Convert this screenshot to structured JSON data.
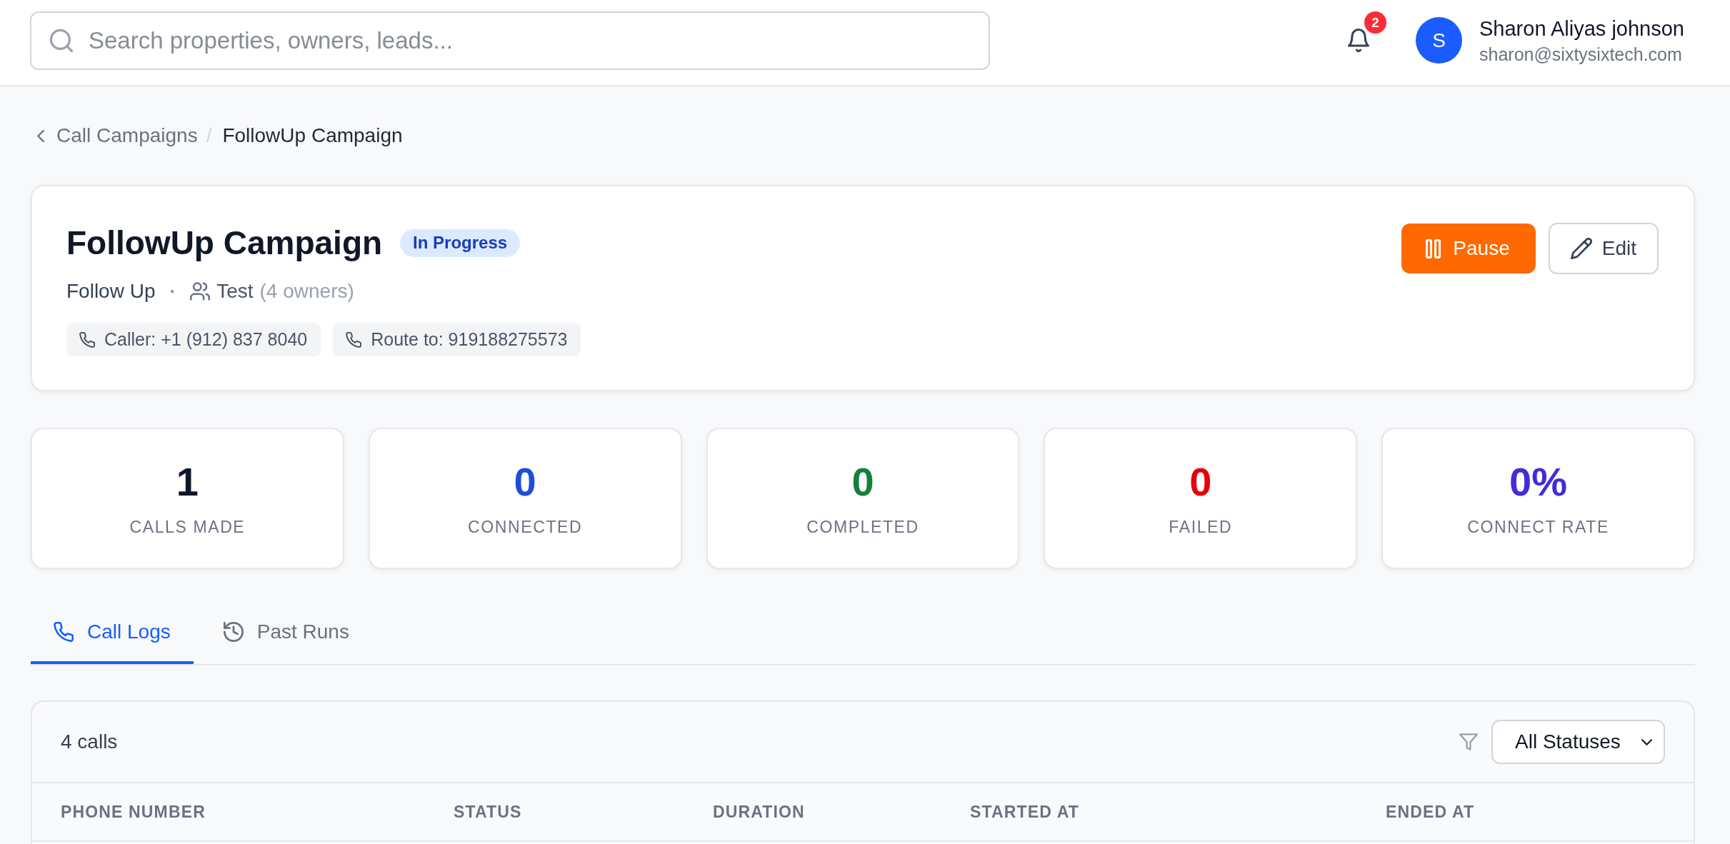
{
  "header": {
    "search": {
      "placeholder": "Search properties, owners, leads..."
    },
    "notifications": {
      "count": "2"
    },
    "user": {
      "initial": "S",
      "name": "Sharon Aliyas johnson",
      "email": "sharon@sixtysixtech.com"
    }
  },
  "breadcrumb": {
    "items": [
      {
        "label": "Call Campaigns",
        "current": false
      },
      {
        "label": "FollowUp Campaign",
        "current": true
      }
    ],
    "separator": "/"
  },
  "campaign": {
    "title": "FollowUp Campaign",
    "status": "In Progress",
    "type": "Follow Up",
    "separator": "·",
    "list": "Test",
    "owners": "(4 owners)",
    "contacts": [
      {
        "label": "Caller: +1 (912) 837 8040"
      },
      {
        "label": "Route to: 919188275573"
      }
    ],
    "actions": [
      {
        "kind": "pause",
        "label": "Pause"
      },
      {
        "kind": "edit",
        "label": "Edit"
      }
    ]
  },
  "stats": [
    {
      "value": "1",
      "label": "CALLS MADE",
      "color": "#101828"
    },
    {
      "value": "0",
      "label": "CONNECTED",
      "color": "#1c4ed8"
    },
    {
      "value": "0",
      "label": "COMPLETED",
      "color": "#15803d"
    },
    {
      "value": "0",
      "label": "FAILED",
      "color": "#e7000b"
    },
    {
      "value": "0%",
      "label": "CONNECT RATE",
      "color": "#432dd7"
    }
  ],
  "tabs": [
    {
      "label": "Call Logs",
      "selected": true
    },
    {
      "label": "Past Runs",
      "selected": false
    }
  ],
  "call_logs": {
    "count": "4 calls",
    "filter": {
      "value": "All Statuses"
    },
    "table": {
      "columns": [
        "PHONE NUMBER",
        "STATUS",
        "DURATION",
        "STARTED AT",
        "ENDED AT"
      ]
    }
  }
}
